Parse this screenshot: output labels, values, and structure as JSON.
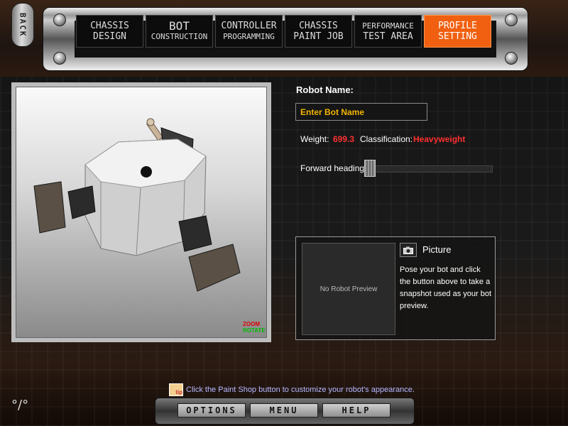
{
  "nav": {
    "back_label": "BACK",
    "tabs": [
      {
        "line1": "CHASSIS",
        "line2": "DESIGN"
      },
      {
        "line1": "BOT",
        "line2": "CONSTRUCTION"
      },
      {
        "line1": "CONTROLLER",
        "line2": "PROGRAMMING"
      },
      {
        "line1": "CHASSIS",
        "line2": "PAINT JOB"
      },
      {
        "line1": "PERFORMANCE",
        "line2": "TEST AREA"
      },
      {
        "line1": "PROFILE",
        "line2": "SETTING"
      }
    ],
    "active_tab": "PROFILE SETTING"
  },
  "preview": {
    "legend_zoom": "ZOOM",
    "legend_rotate": "ROTATE"
  },
  "profile": {
    "robot_name_label": "Robot Name:",
    "robot_name_placeholder": "Enter Bot Name",
    "weight_label": "Weight:",
    "weight_value": "699.3",
    "classification_label": "Classification:",
    "classification_value": "Heavyweight",
    "heading_label": "Forward heading:"
  },
  "picture": {
    "no_preview_text": "No Robot Preview",
    "title": "Picture",
    "description": "Pose your bot and click the button above to take a snapshot used as your bot preview."
  },
  "footer": {
    "tip_icon_text": "tip",
    "tip_text": "Click the Paint Shop button to customize your robot's appearance.",
    "buttons": [
      "OPTIONS",
      "MENU",
      "HELP"
    ]
  },
  "colors": {
    "active_tab": "#f06010",
    "name_text": "#f0b400",
    "warning_red": "#ff3030",
    "tip_text": "#b7b7ff"
  }
}
